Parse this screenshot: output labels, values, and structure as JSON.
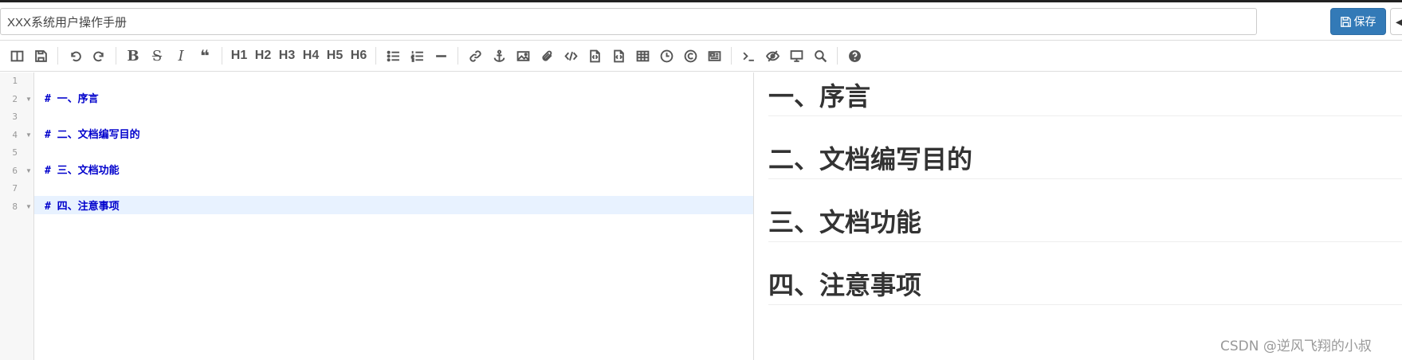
{
  "header": {
    "title_value": "XXX系统用户操作手册",
    "save_label": "保存",
    "save_color": "#337ab7"
  },
  "toolbar": {
    "headings": [
      "H1",
      "H2",
      "H3",
      "H4",
      "H5",
      "H6"
    ]
  },
  "editor": {
    "lines": [
      {
        "num": "1",
        "text": ""
      },
      {
        "num": "2",
        "text": "# 一、序言"
      },
      {
        "num": "3",
        "text": ""
      },
      {
        "num": "4",
        "text": "# 二、文档编写目的"
      },
      {
        "num": "5",
        "text": ""
      },
      {
        "num": "6",
        "text": "# 三、文档功能"
      },
      {
        "num": "7",
        "text": ""
      },
      {
        "num": "8",
        "text": "# 四、注意事项"
      }
    ]
  },
  "preview": {
    "headings": [
      "一、序言",
      "二、文档编写目的",
      "三、文档功能",
      "四、注意事项"
    ]
  },
  "watermark": "CSDN @逆风飞翔的小叔"
}
